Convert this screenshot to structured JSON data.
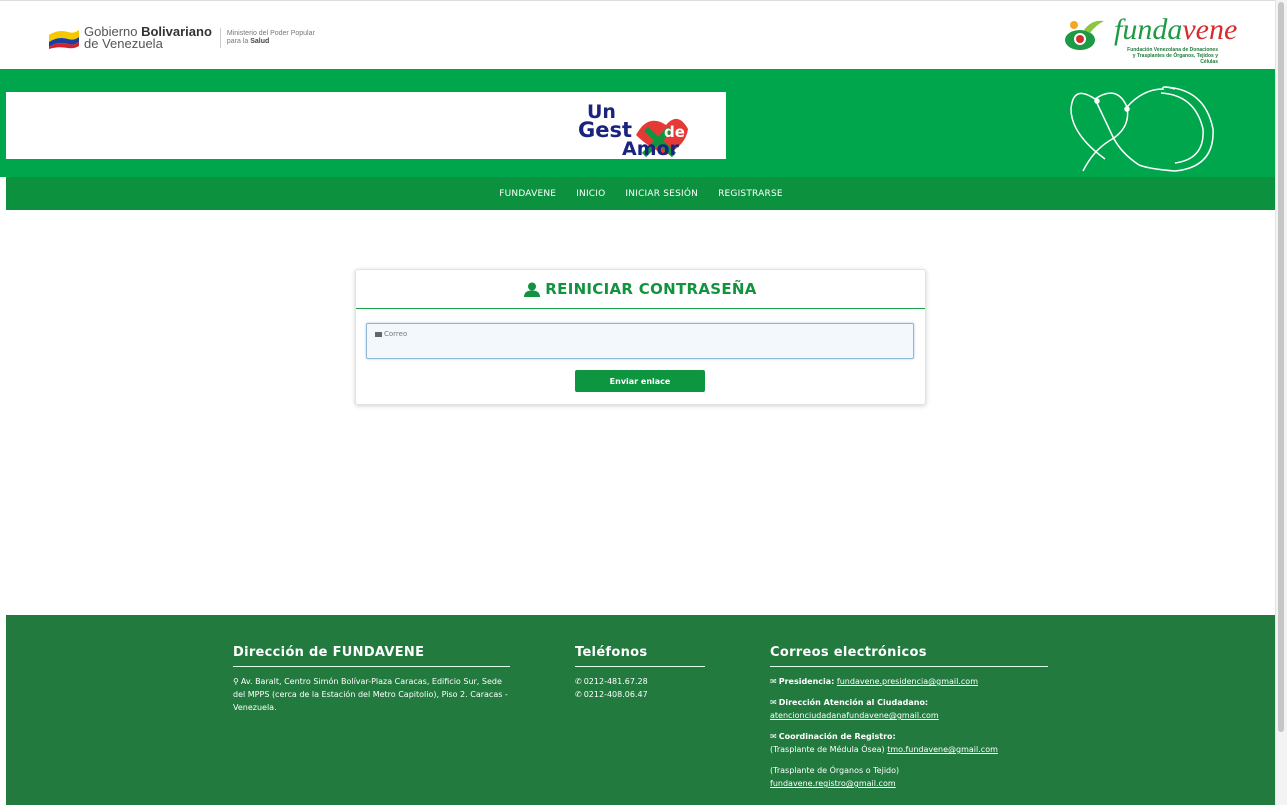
{
  "header": {
    "gov_line1_prefix": "Gobierno ",
    "gov_line1_bold": "Bolivariano",
    "gov_line2": "de Venezuela",
    "ministry_line1": "Ministerio del Poder Popular",
    "ministry_line2_prefix": "para la ",
    "ministry_line2_bold": "Salud",
    "brand_part1": "funda",
    "brand_part2": "vene",
    "brand_sub1": "Fundación Venezolana de Donaciones",
    "brand_sub2": "y Trasplantes de Órganos, Tejidos y Células"
  },
  "banner": {
    "logo_line1": "Un",
    "logo_line2": "Gest",
    "logo_de": "de",
    "logo_line3": "Amor"
  },
  "nav": {
    "items": [
      "FUNDAVENE",
      "INICIO",
      "INICIAR SESIÓN",
      "REGISTRARSE"
    ]
  },
  "form": {
    "title": "REINICIAR CONTRASEÑA",
    "email_label": "Correo",
    "email_value": "",
    "submit_label": "Enviar enlace"
  },
  "footer": {
    "address": {
      "heading": "Dirección de FUNDAVENE",
      "text": "Av. Baralt, Centro Simón Bolívar-Plaza Caracas, Edificio Sur, Sede del MPPS (cerca de la Estación del Metro Capitolio), Piso 2. Caracas - Venezuela."
    },
    "phones": {
      "heading": "Teléfonos",
      "items": [
        "0212-481.67.28",
        "0212-408.06.47"
      ]
    },
    "emails": {
      "heading": "Correos electrónicos",
      "presidencia_label": "Presidencia:",
      "presidencia_email": "fundavene.presidencia@gmail.com",
      "atencion_label": "Dirección Atención al Ciudadano:",
      "atencion_email": "atencionciudadanafundavene@gmail.com",
      "registro_label": "Coordinación de Registro:",
      "medula_text": "(Trasplante de Médula Ósea)",
      "medula_email": "tmo.fundavene@gmail.com",
      "organos_text": "(Trasplante de Órganos o Tejido)",
      "organos_email": "fundavene.registro@gmail.com"
    }
  },
  "colors": {
    "primary_green": "#00a64b",
    "nav_green": "#0c923e",
    "footer_green": "#237a3f",
    "brand_red": "#d82b2b"
  },
  "icons": [
    "venezuela-flag-icon",
    "fundavene-logo-icon",
    "ribbon-heart-icon",
    "user-icon",
    "envelope-icon",
    "map-marker-icon",
    "phone-icon"
  ]
}
